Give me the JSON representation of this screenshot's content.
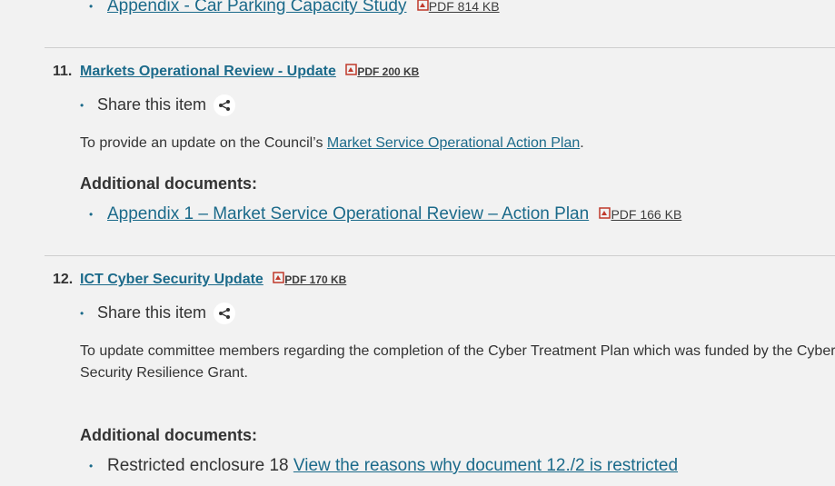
{
  "top_doc": {
    "label": "Appendix - Car Parking Capacity Study",
    "pdf": "PDF 814 KB"
  },
  "items": [
    {
      "number": "11.",
      "title": "Markets Operational Review - Update",
      "pdf": "PDF 200 KB",
      "share_label": "Share this item",
      "desc_prefix": "To provide an update on the Council’s ",
      "desc_link": "Market Service Operational Action Plan",
      "desc_suffix": ".",
      "additional_heading": "Additional documents:",
      "doc_label": "Appendix 1 – Market Service Operational Review – Action Plan",
      "doc_pdf": "PDF 166 KB"
    },
    {
      "number": "12.",
      "title": "ICT Cyber Security Update",
      "pdf": "PDF 170 KB",
      "share_label": "Share this item",
      "desc_line1": "To update committee members regarding the completion of the Cyber Treatment Plan which was funded by the Cyber",
      "desc_line2": "Security Resilience Grant.",
      "additional_heading": "Additional documents:",
      "restricted_text": "Restricted enclosure 18 ",
      "restricted_link": "View the reasons why document 12./2 is restricted"
    }
  ],
  "icons": {
    "pdf": "pdf-icon",
    "share": "share-icon"
  },
  "colors": {
    "link": "#1b6a8a",
    "background": "#f2f2f2",
    "pdf_icon": "#c0392b"
  }
}
